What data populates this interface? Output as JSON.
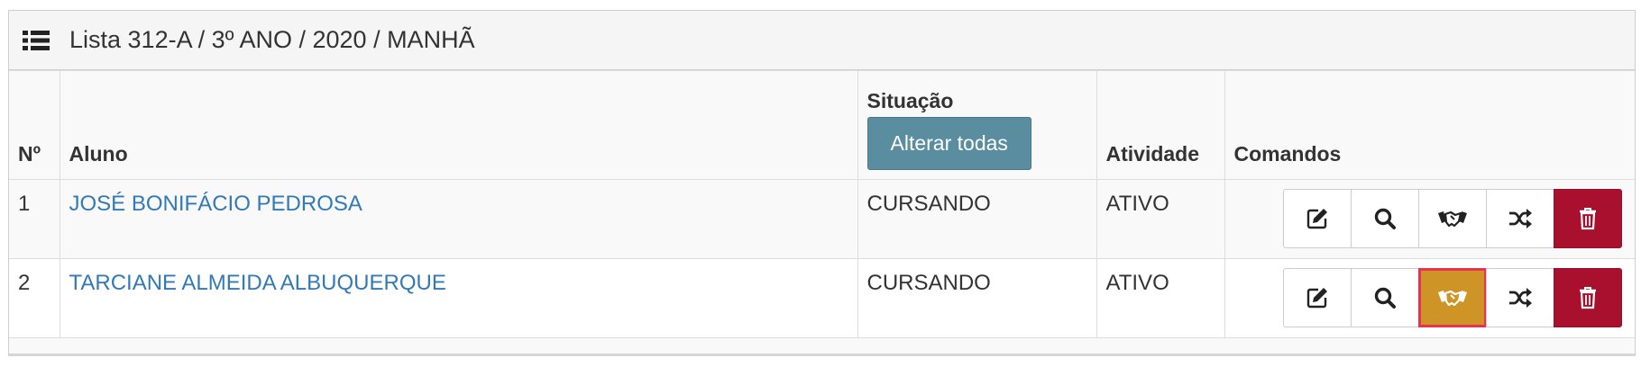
{
  "panel": {
    "icon": "list-icon",
    "title": "Lista 312-A / 3º ANO / 2020 / MANHÃ"
  },
  "table": {
    "headers": {
      "num": "Nº",
      "aluno": "Aluno",
      "situacao": "Situação",
      "alterar_todas": "Alterar todas",
      "atividade": "Atividade",
      "comandos": "Comandos"
    },
    "rows": [
      {
        "num": "1",
        "aluno": "JOSÉ BONIFÁCIO PEDROSA",
        "situacao": "CURSANDO",
        "atividade": "ATIVO"
      },
      {
        "num": "2",
        "aluno": "TARCIANE ALMEIDA ALBUQUERQUE",
        "situacao": "CURSANDO",
        "atividade": "ATIVO"
      }
    ],
    "command_icons": [
      "edit-icon",
      "search-icon",
      "handshake-icon",
      "shuffle-icon",
      "trash-icon"
    ]
  },
  "colors": {
    "link": "#3379b6",
    "alterar_button": "#5a8da0",
    "delete_button": "#a8102d",
    "highlight_button": "#cf9426",
    "highlight_border": "#e6344f"
  }
}
